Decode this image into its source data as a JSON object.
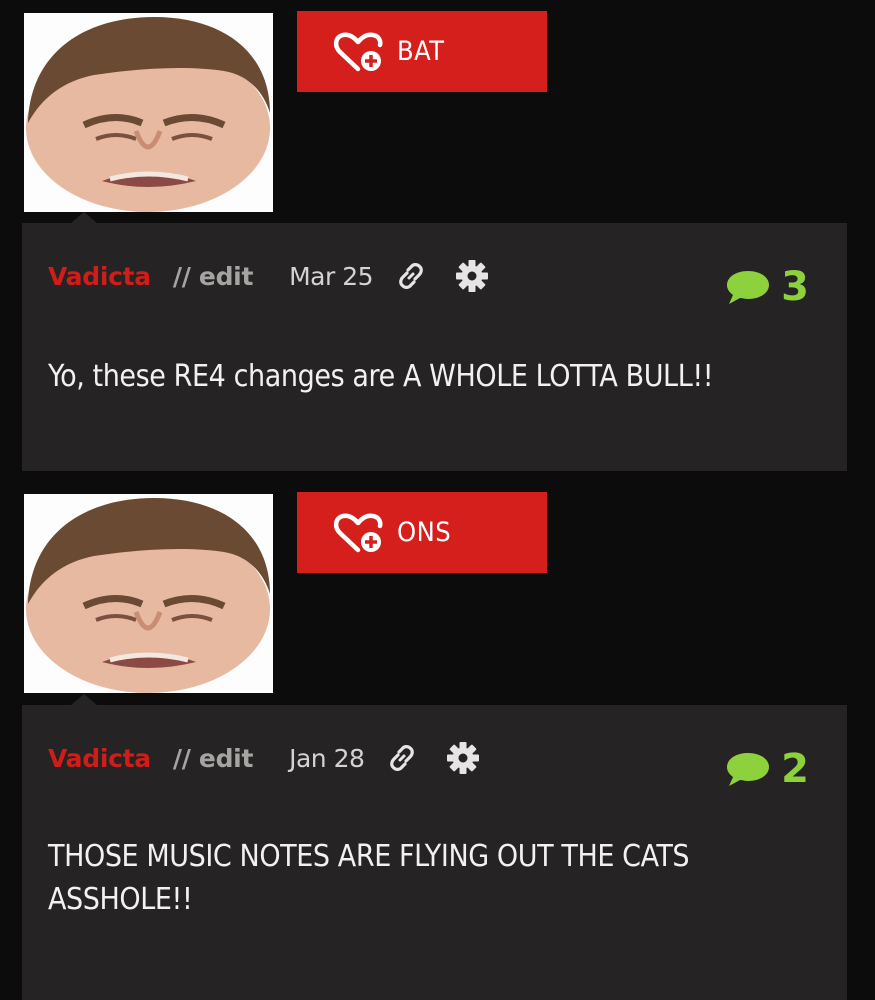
{
  "posts": [
    {
      "tag_label": "BAT",
      "author": "Vadicta",
      "edit_label": "// edit",
      "date": "Mar 25",
      "comment_count": "3",
      "body": "Yo, these RE4 changes are A WHOLE LOTTA BULL!!"
    },
    {
      "tag_label": "ONS",
      "author": "Vadicta",
      "edit_label": "// edit",
      "date": "Jan 28",
      "comment_count": "2",
      "body": "THOSE MUSIC NOTES ARE FLYING OUT THE CATS ASSHOLE!!"
    }
  ],
  "colors": {
    "background": "#0d0c0c",
    "card": "#252323",
    "accent_red": "#d41f1c",
    "author_red": "#cf1d1a",
    "comment_green": "#8dd13c"
  },
  "icons": [
    "heart-plus-icon",
    "link-icon",
    "gear-icon",
    "comment-bubble-icon"
  ]
}
